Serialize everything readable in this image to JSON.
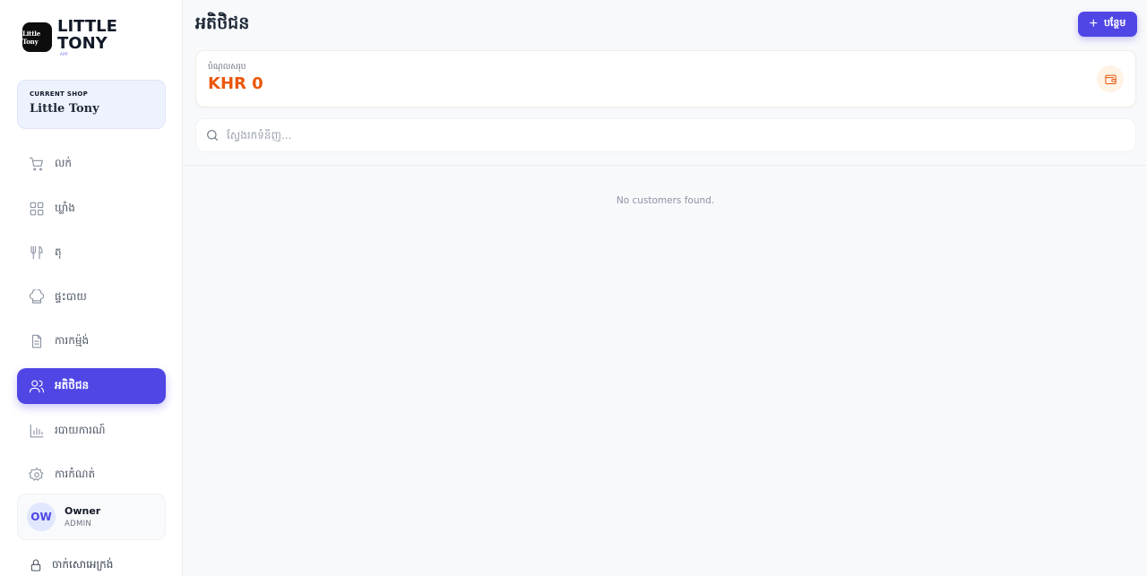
{
  "brand": {
    "logo_text": "Little Tony",
    "name": "LITTLE TONY",
    "sub": "APP"
  },
  "shop": {
    "caption": "CURRENT SHOP",
    "name": "Little Tony"
  },
  "nav": {
    "items": [
      {
        "label": "លក់",
        "icon": "cart-icon",
        "active": false
      },
      {
        "label": "ឃ្លាំង",
        "icon": "grid-icon",
        "active": false
      },
      {
        "label": "តុ",
        "icon": "utensils-icon",
        "active": false
      },
      {
        "label": "ផ្ទះបាយ",
        "icon": "chef-hat-icon",
        "active": false
      },
      {
        "label": "ការកម្ម៉ង់",
        "icon": "document-icon",
        "active": false
      },
      {
        "label": "អតិថិជន",
        "icon": "users-icon",
        "active": true
      },
      {
        "label": "របាយការណ៍",
        "icon": "bar-chart-icon",
        "active": false
      },
      {
        "label": "ការកំណត់",
        "icon": "gear-icon",
        "active": false
      }
    ]
  },
  "user": {
    "initials": "OW",
    "name": "Owner",
    "role": "ADMIN"
  },
  "logout": {
    "label": "ចាក់សោអេក្រង់"
  },
  "header": {
    "title": "អតិថិជន",
    "add_label": "បន្ថែម"
  },
  "summary": {
    "label": "បំណុលសរុប",
    "value": "KHR 0"
  },
  "search": {
    "placeholder": "ស្វែងរកទំនិញ...",
    "value": ""
  },
  "empty_message": "No customers found.",
  "colors": {
    "accent": "#5046e5",
    "debt": "#ea580c"
  }
}
